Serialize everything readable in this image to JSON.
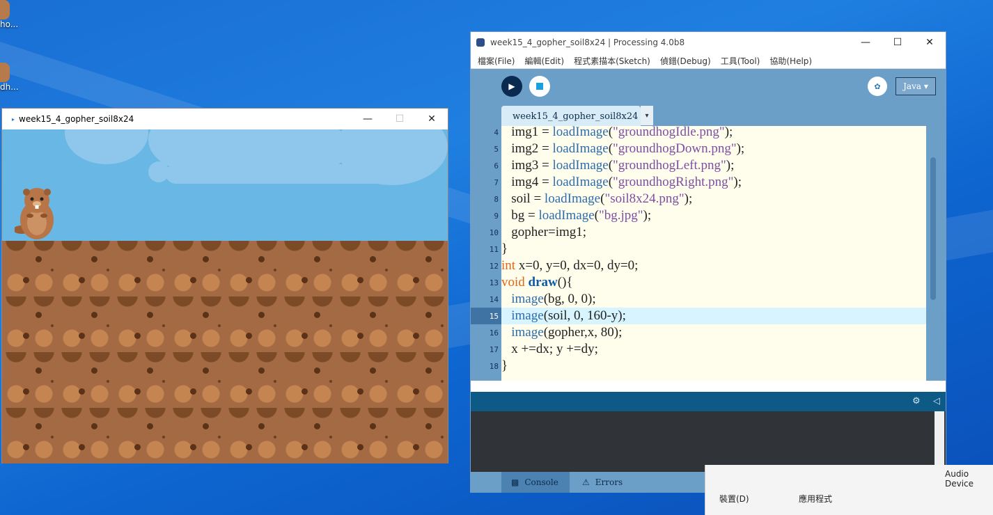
{
  "desktop": {
    "icons": [
      {
        "label": "ho..."
      },
      {
        "label": "dh..."
      }
    ]
  },
  "sketch_window": {
    "title": "week15_4_gopher_soil8x24"
  },
  "pde_window": {
    "title": "week15_4_gopher_soil8x24 | Processing 4.0b8",
    "menu": [
      "檔案(File)",
      "編輯(Edit)",
      "程式素描本(Sketch)",
      "偵錯(Debug)",
      "工具(Tool)",
      "協助(Help)"
    ],
    "mode_label": "Java ▾",
    "tab_label": "week15_4_gopher_soil8x24",
    "tab_arrow": "▾",
    "current_line": 15,
    "code_lines": [
      {
        "n": "4",
        "text": "   img1 = loadImage(\"groundhogIdle.png\");"
      },
      {
        "n": "5",
        "text": "   img2 = loadImage(\"groundhogDown.png\");"
      },
      {
        "n": "6",
        "text": "   img3 = loadImage(\"groundhogLeft.png\");"
      },
      {
        "n": "7",
        "text": "   img4 = loadImage(\"groundhogRight.png\");"
      },
      {
        "n": "8",
        "text": "   soil = loadImage(\"soil8x24.png\");"
      },
      {
        "n": "9",
        "text": "   bg = loadImage(\"bg.jpg\");"
      },
      {
        "n": "10",
        "text": "   gopher=img1;"
      },
      {
        "n": "11",
        "text": "}"
      },
      {
        "n": "12",
        "text": "int x=0, y=0, dx=0, dy=0;"
      },
      {
        "n": "13",
        "text": "void draw(){"
      },
      {
        "n": "14",
        "text": "   image(bg, 0, 0);"
      },
      {
        "n": "15",
        "text": "   image(soil, 0, 160-y);"
      },
      {
        "n": "16",
        "text": "   image(gopher,x, 80);"
      },
      {
        "n": "17",
        "text": "   x +=dx; y +=dy;"
      },
      {
        "n": "18",
        "text": "}"
      }
    ],
    "bottom_tabs": {
      "console": "Console",
      "errors": "Errors"
    }
  },
  "side_panel": {
    "audio_label": "Audio Device",
    "device_label": "裝置(D)",
    "apps_label": "應用程式"
  }
}
